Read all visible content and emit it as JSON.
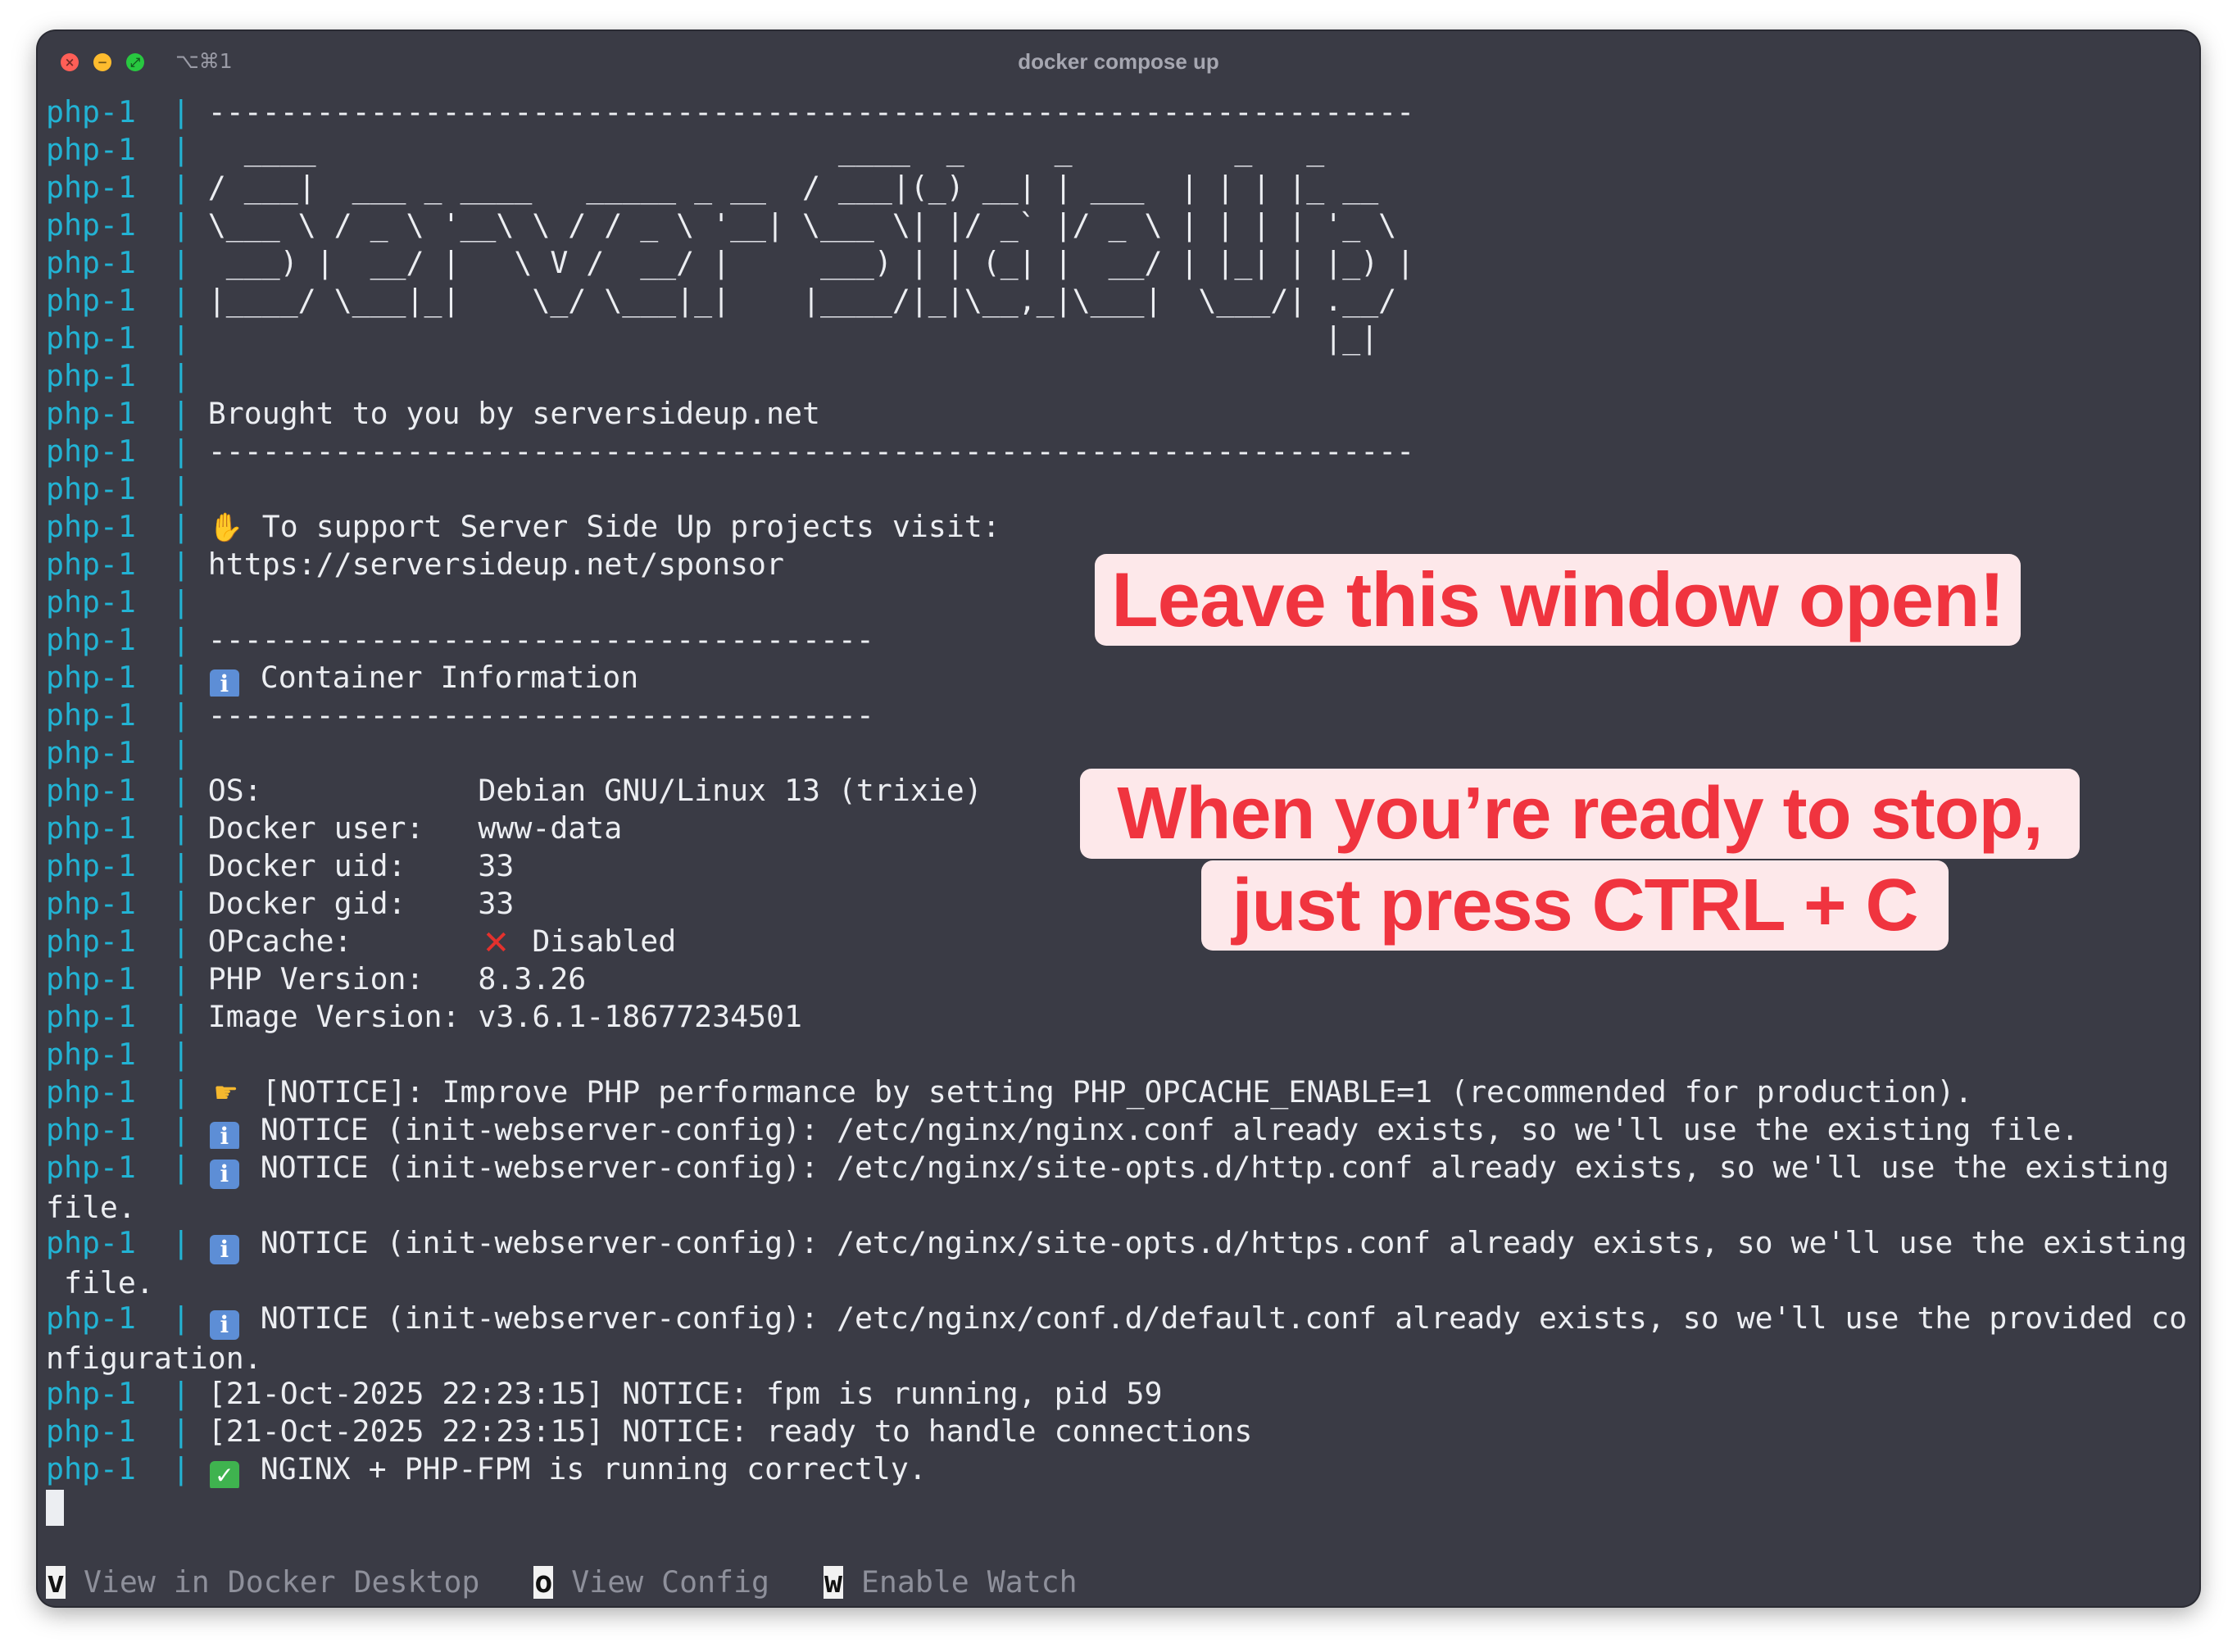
{
  "window": {
    "title": "docker compose up",
    "shortcut": "⌥⌘1"
  },
  "prefix": "php-1",
  "separator": "|",
  "lines": [
    {
      "text": "-------------------------------------------------------------------"
    },
    {
      "text": "  ____                             ____  _     _         _   _       "
    },
    {
      "text": "/ ___|  ___ _ ____   _____ _ __  / ___|(_) __| | ___  | | | |_ __  "
    },
    {
      "text": "\\___ \\ / _ \\ '__\\ \\ / / _ \\ '__| \\___ \\| |/ _` |/ _ \\ | | | | '_ \\ "
    },
    {
      "text": " ___) |  __/ |   \\ V /  __/ |     ___) | | (_| |  __/ | |_| | |_) |"
    },
    {
      "text": "|____/ \\___|_|    \\_/ \\___|_|    |____/|_|\\__,_|\\___|  \\___/| .__/ "
    },
    {
      "text": "                                                              |_|    "
    },
    {
      "text": ""
    },
    {
      "text": "Brought to you by serversideup.net"
    },
    {
      "text": "-------------------------------------------------------------------"
    },
    {
      "text": ""
    },
    {
      "icon": "raised-hands",
      "text": " To support Server Side Up projects visit:"
    },
    {
      "text": "https://serversideup.net/sponsor"
    },
    {
      "text": ""
    },
    {
      "text": "-------------------------------------"
    },
    {
      "icon": "info",
      "text": " Container Information"
    },
    {
      "text": "-------------------------------------"
    },
    {
      "text": ""
    },
    {
      "text": "OS:            Debian GNU/Linux 13 (trixie)"
    },
    {
      "text": "Docker user:   www-data"
    },
    {
      "text": "Docker uid:    33"
    },
    {
      "text": "Docker gid:    33"
    },
    {
      "text": "OPcache:       ",
      "icon_after": "cross",
      "text2": " Disabled"
    },
    {
      "text": "PHP Version:   8.3.26"
    },
    {
      "text": "Image Version: v3.6.1-18677234501"
    },
    {
      "text": ""
    },
    {
      "icon": "point-right",
      "text": " [NOTICE]: Improve PHP performance by setting PHP_OPCACHE_ENABLE=1 (recommended for production)."
    },
    {
      "icon": "info",
      "text": " NOTICE (init-webserver-config): /etc/nginx/nginx.conf already exists, so we'll use the existing file."
    },
    {
      "icon": "info",
      "text": " NOTICE (init-webserver-config): /etc/nginx/site-opts.d/http.conf already exists, so we'll use the existing ",
      "wrap": "file."
    },
    {
      "icon": "info",
      "text": " NOTICE (init-webserver-config): /etc/nginx/site-opts.d/https.conf already exists, so we'll use the existing",
      "wrap": " file."
    },
    {
      "icon": "info",
      "text": " NOTICE (init-webserver-config): /etc/nginx/conf.d/default.conf already exists, so we'll use the provided co",
      "wrap": "nfiguration."
    },
    {
      "text": "[21-Oct-2025 22:23:15] NOTICE: fpm is running, pid 59"
    },
    {
      "text": "[21-Oct-2025 22:23:15] NOTICE: ready to handle connections"
    },
    {
      "icon": "check",
      "text": " NGINX + PHP-FPM is running correctly."
    }
  ],
  "footer": [
    {
      "key": "v",
      "label": " View in Docker Desktop"
    },
    {
      "key": "o",
      "label": " View Config"
    },
    {
      "key": "w",
      "label": " Enable Watch"
    }
  ],
  "callouts": {
    "leave_open": "Leave this window open!",
    "stop_line1": "When you’re ready to stop,",
    "stop_line2": "just press CTRL + C"
  },
  "colors": {
    "background": "#3a3b45",
    "prefix": "#22b3d4",
    "text": "#eceef2",
    "callout_text": "#f0343f",
    "callout_bg": "#fde8ea"
  }
}
